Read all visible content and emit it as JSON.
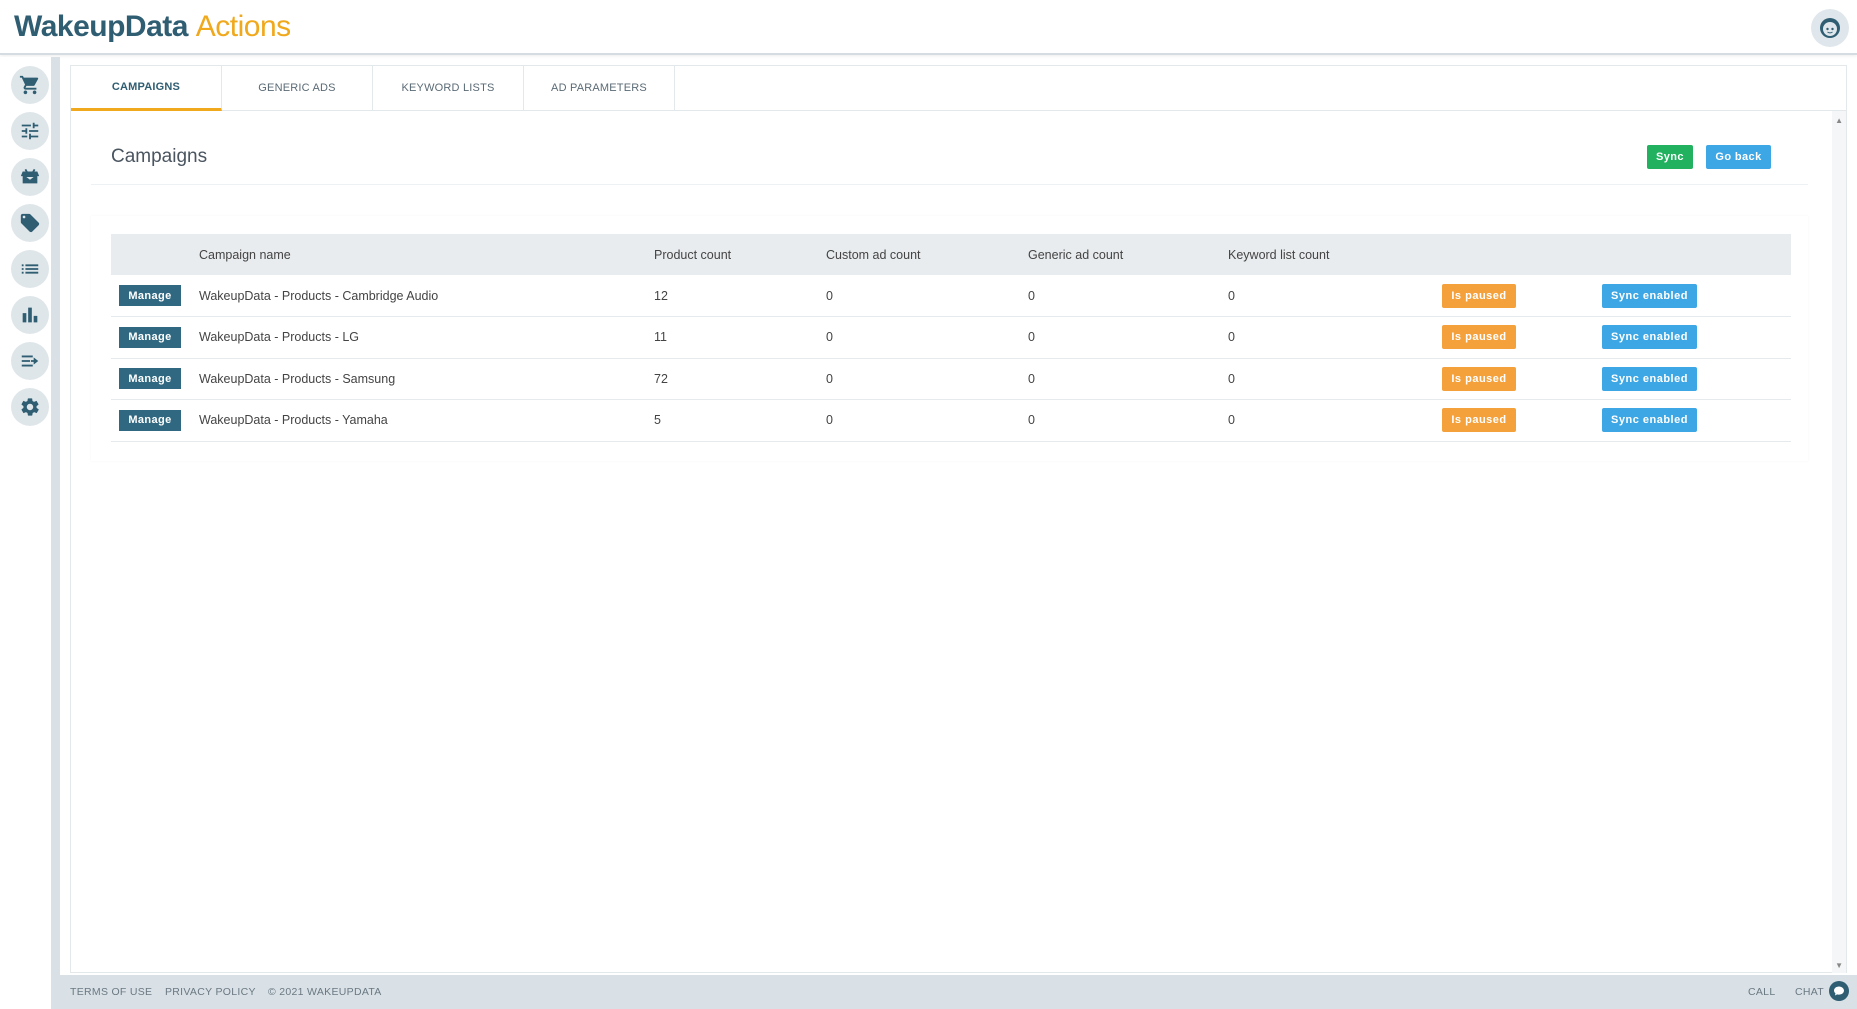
{
  "header": {
    "brand": "WakeupData",
    "product": "Actions"
  },
  "tabs": [
    {
      "label": "CAMPAIGNS",
      "active": true
    },
    {
      "label": "GENERIC ADS",
      "active": false
    },
    {
      "label": "KEYWORD LISTS",
      "active": false
    },
    {
      "label": "AD PARAMETERS",
      "active": false
    }
  ],
  "sidebar": {
    "items": [
      {
        "icon": "cart-icon"
      },
      {
        "icon": "sliders-icon"
      },
      {
        "icon": "box-icon"
      },
      {
        "icon": "tag-icon"
      },
      {
        "icon": "list-icon"
      },
      {
        "icon": "bar-chart-icon"
      },
      {
        "icon": "export-icon"
      },
      {
        "icon": "gear-icon"
      }
    ]
  },
  "page": {
    "title": "Campaigns",
    "sync_label": "Sync",
    "back_label": "Go back"
  },
  "table": {
    "columns": [
      "",
      "Campaign name",
      "Product count",
      "Custom ad count",
      "Generic ad count",
      "Keyword list count",
      "",
      ""
    ],
    "manage_label": "Manage",
    "rows": [
      {
        "name": "WakeupData - Products - Cambridge Audio",
        "product_count": "12",
        "custom_ad_count": "0",
        "generic_ad_count": "0",
        "keyword_list_count": "0",
        "status": "Is paused",
        "sync": "Sync enabled"
      },
      {
        "name": "WakeupData - Products - LG",
        "product_count": "11",
        "custom_ad_count": "0",
        "generic_ad_count": "0",
        "keyword_list_count": "0",
        "status": "Is paused",
        "sync": "Sync enabled"
      },
      {
        "name": "WakeupData - Products - Samsung",
        "product_count": "72",
        "custom_ad_count": "0",
        "generic_ad_count": "0",
        "keyword_list_count": "0",
        "status": "Is paused",
        "sync": "Sync enabled"
      },
      {
        "name": "WakeupData - Products - Yamaha",
        "product_count": "5",
        "custom_ad_count": "0",
        "generic_ad_count": "0",
        "keyword_list_count": "0",
        "status": "Is paused",
        "sync": "Sync enabled"
      }
    ]
  },
  "footer": {
    "terms": "TERMS OF USE",
    "privacy": "PRIVACY POLICY",
    "copyright": "© 2021 WAKEUPDATA",
    "call": "CALL",
    "chat": "CHAT"
  },
  "colors": {
    "brand": "#2f5d72",
    "accent": "#f0a81c",
    "sync_green": "#21b15f",
    "blue": "#3da7e6",
    "paused_orange": "#f5a13b"
  }
}
